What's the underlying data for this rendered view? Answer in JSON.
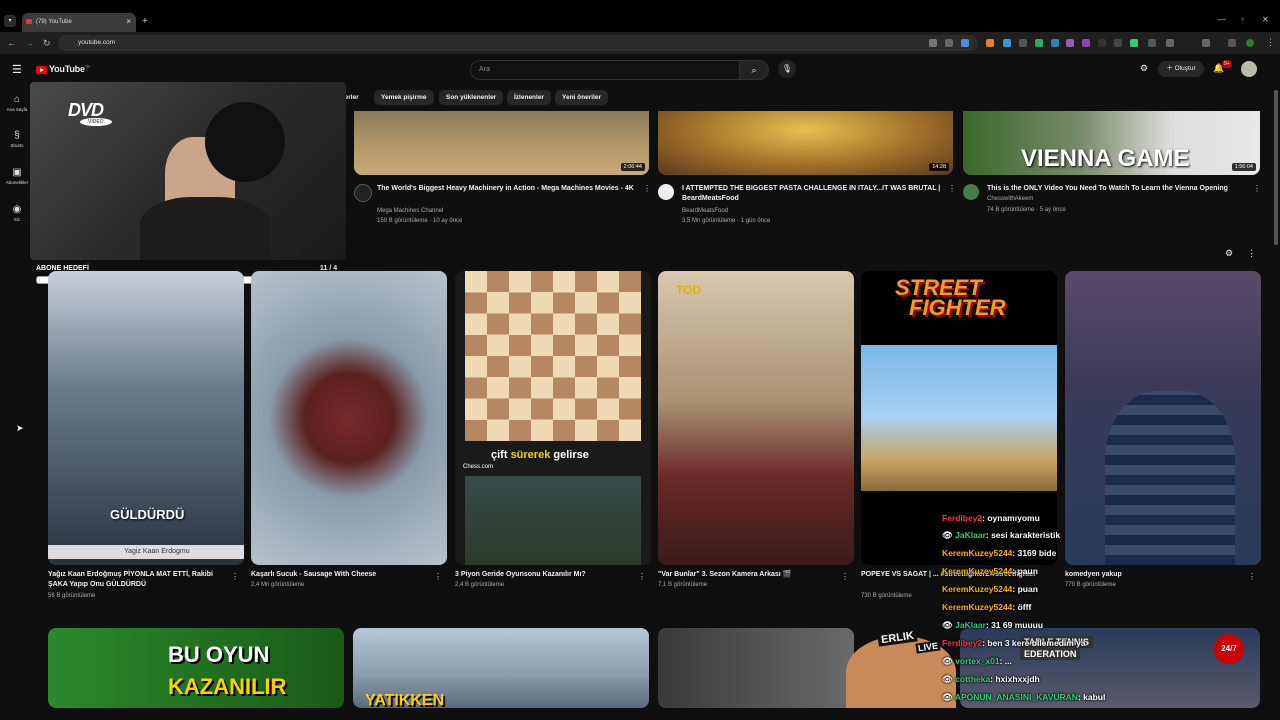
{
  "browser": {
    "tab_title": "(79) YouTube",
    "url": "youtube.com",
    "new_tab": "+",
    "tab_close": "×"
  },
  "header": {
    "logo_text": "YouTube",
    "logo_sup": "TR",
    "search_placeholder": "Ara",
    "create_label": "Oluştur",
    "notif_badge": "9+"
  },
  "sidebar": [
    {
      "label": "Ana Sayfa",
      "icon": "home-icon"
    },
    {
      "label": "Shorts",
      "icon": "shorts-icon"
    },
    {
      "label": "Abonelikler",
      "icon": "subscriptions-icon"
    },
    {
      "label": "Siz",
      "icon": "you-icon"
    }
  ],
  "chips": [
    "yerler",
    "Yemek pişirme",
    "Son yüklenenler",
    "İzlenenler",
    "Yeni öneriler"
  ],
  "videos": [
    {
      "title": "The World's Biggest Heavy Machinery in Action - Mega Machines Movies - 4K",
      "channel": "Mega Machines Channel",
      "meta": "159 B görüntüleme · 10 ay önce",
      "duration": "2:06:44"
    },
    {
      "title": "I ATTEMPTED THE BIGGEST PASTA CHALLENGE IN ITALY...IT WAS BRUTAL | BeardMeatsFood",
      "channel": "BeardMeatsFood",
      "meta": "3,5 Mn görüntüleme · 1 gün önce",
      "duration": "14:28"
    },
    {
      "title": "This is the ONLY Video You Need To Watch To Learn the Vienna Opening",
      "channel": "ChesswithAkeem",
      "meta": "74 B görüntüleme · 5 ay önce",
      "duration": "1:56:04",
      "thumb_text": "VIENNA GAME"
    }
  ],
  "overlay": {
    "dvd": "DVD",
    "dvd_sub": "VIDEO",
    "goal_label": "ABONE HEDEFİ",
    "goal_count": "11 / 4"
  },
  "shorts": [
    {
      "title": "Yağız Kaan Erdoğmuş PİYONLA MAT ETTİ, Rakibi ŞAKA Yapıp Onu GÜLDÜRDÜ",
      "views": "56 B görüntüleme",
      "caption": "GÜLDÜRDÜ",
      "nameplate": "Yagiz Kaan Erdogmu"
    },
    {
      "title": "Kaşarlı Sucuk - Sausage With Cheese",
      "views": "2,4 Mn görüntüleme"
    },
    {
      "title": "3 Piyon Geride Oyunsonu Kazanılır Mı?",
      "views": "2,4 B görüntüleme",
      "caption_a": "çift",
      "caption_b": "sürerek",
      "caption_c": "gelirse",
      "brand": "Chess.com"
    },
    {
      "title": "\"Var Bunlar\" 3. Sezon Kamera Arkası 🎬",
      "views": "7,1 B görüntüleme",
      "badge": "TOD"
    },
    {
      "title": "POPEYE VS SAGAT | ... #streetfighter2 #streetfighter",
      "views": "730 B görüntüleme",
      "logo_a": "STREET",
      "logo_b": "FIGHTER"
    },
    {
      "title": "komedyen yakup",
      "views": "779 B görüntüleme"
    }
  ],
  "chat": [
    {
      "user": "Ferdibey2",
      "msg": ": oynamıyomu",
      "color": "#ffb000"
    },
    {
      "user": "JaKlaar",
      "msg": ": sesi karakteristik",
      "color": "#2ecc71"
    },
    {
      "user": "KeremKuzey5244",
      "msg": ": 3169 bide",
      "color": "#ffb000"
    },
    {
      "user": "KeremKuzey5244",
      "msg": ": paun",
      "color": "#ffb000"
    },
    {
      "user": "KeremKuzey5244",
      "msg": ": puan",
      "color": "#ffb000"
    },
    {
      "user": "KeremKuzey5244",
      "msg": ": öfff",
      "color": "#ffb000"
    },
    {
      "user": "JaKlaar",
      "msg": ": 31 69 muuuu",
      "color": "#2ecc71"
    },
    {
      "user": "Ferdibey2",
      "msg": ": ben 3 kere bilemedim ya",
      "color": "#ff3030"
    },
    {
      "user": "vortex_x01",
      "msg": ": ...",
      "color": "#2ecc71"
    },
    {
      "user": "cottheka",
      "msg": ": hxixhxxjdh",
      "color": "#2ecc71"
    },
    {
      "user": "APONUN_ANASINI_KAVURAN",
      "msg": ": kabul",
      "color": "#2ecc71"
    }
  ],
  "bottom": {
    "thumb1_line1": "BU OYUN",
    "thumb1_line2": "KAZANILIR",
    "thumb2_text": "YATIKKEN",
    "live_name": "ERLIK",
    "live_word": "LIVE",
    "live_badge": "24/7",
    "tt_line1": "TABLE TENNIS",
    "tt_line2": "EDERATION"
  }
}
